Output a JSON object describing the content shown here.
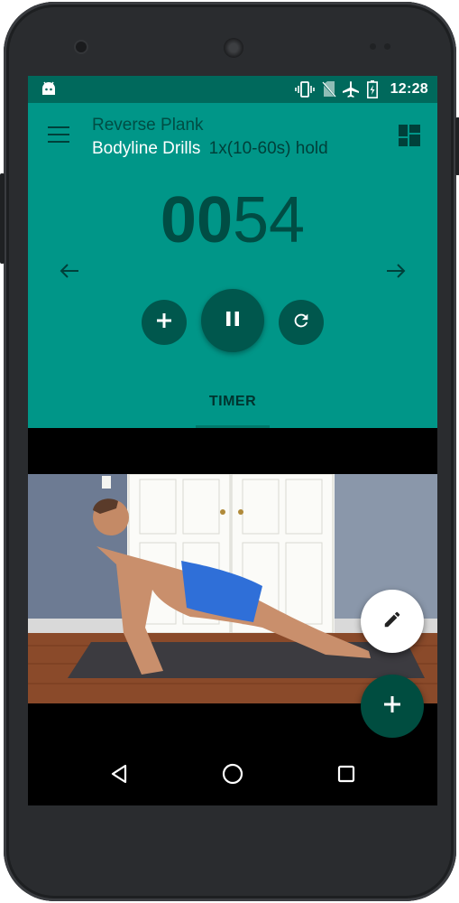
{
  "status_bar": {
    "time": "12:28",
    "icons": [
      "android-notification-icon",
      "vibrate-icon",
      "no-sim-icon",
      "airplane-mode-icon",
      "battery-charging-icon"
    ]
  },
  "header": {
    "subtitle": "Reverse Plank",
    "title": "Bodyline Drills",
    "prescription": "1x(10-60s) hold",
    "icons": [
      "menu-icon",
      "dashboard-icon"
    ]
  },
  "timer": {
    "minutes": "00",
    "seconds": "54"
  },
  "controls": {
    "icons": [
      "previous-arrow-icon",
      "next-arrow-icon",
      "add-icon",
      "pause-icon",
      "restart-icon"
    ]
  },
  "tabs": [
    {
      "label": "TIMER",
      "selected": true
    }
  ],
  "fabs": {
    "icons": [
      "edit-icon",
      "add-icon"
    ]
  },
  "nav_bar": {
    "icons": [
      "back-icon",
      "home-icon",
      "recents-icon"
    ]
  },
  "colors": {
    "status_bar": "#00695c",
    "app_bar": "#009688",
    "dark_accent": "#00574d",
    "fab_edit": "#ffffff",
    "fab_add": "#004d40"
  }
}
